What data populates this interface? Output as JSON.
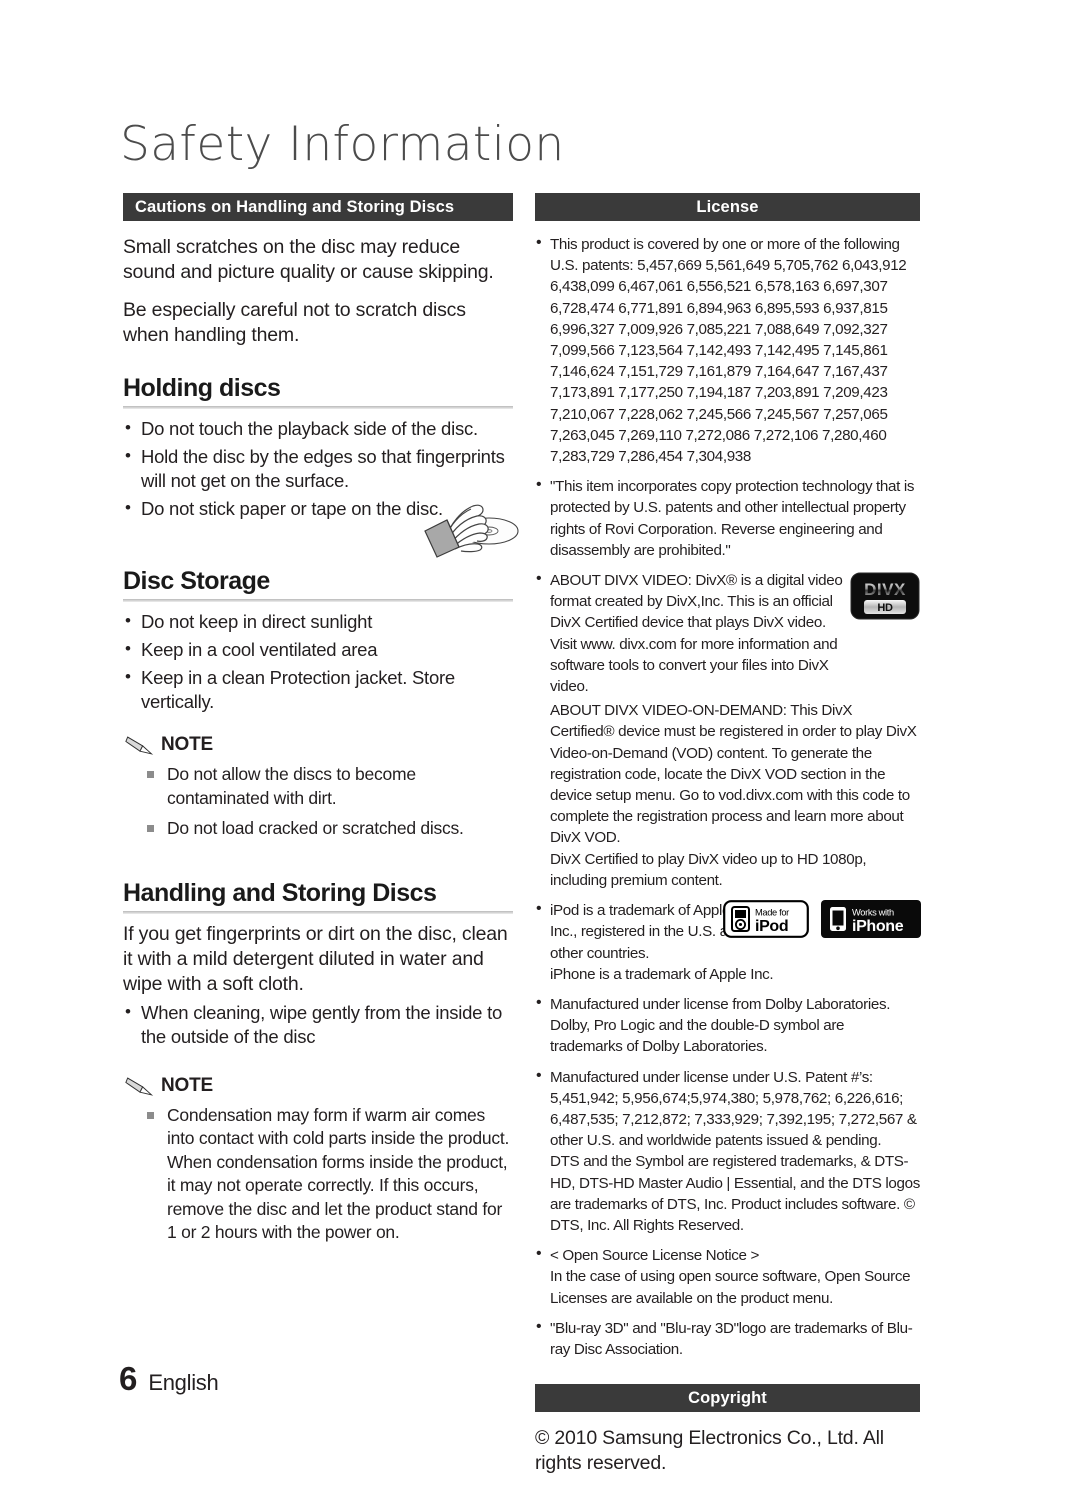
{
  "page": {
    "title": "Safety Information",
    "number": "6",
    "language": "English"
  },
  "left": {
    "header_bar": "Cautions on Handling and Storing Discs",
    "intro": [
      "Small scratches on the disc may reduce sound and picture quality or cause skipping.",
      "Be especially careful not to scratch discs when handling them."
    ],
    "holding": {
      "heading": "Holding discs",
      "bullets": [
        "Do not touch the playback side of the disc.",
        "Hold the disc by the edges so that fingerprints will not get on the surface.",
        "Do not stick paper or tape on the disc."
      ]
    },
    "storage": {
      "heading": "Disc Storage",
      "bullets": [
        "Do not keep in direct sunlight",
        "Keep in a cool ventilated area",
        "Keep in a clean Protection jacket. Store vertically."
      ],
      "note_label": "NOTE",
      "notes": [
        "Do not allow the discs to become contaminated with dirt.",
        "Do not load cracked or scratched discs."
      ]
    },
    "handling": {
      "heading": "Handling and Storing Discs",
      "paragraph": "If you get fingerprints or dirt on the disc, clean it with a mild detergent diluted in water and wipe with a soft cloth.",
      "bullets": [
        "When cleaning, wipe gently from the inside to the outside of the disc"
      ],
      "note_label": "NOTE",
      "notes": [
        "Condensation may form if warm air comes into contact with cold parts inside the product. When condensation forms inside the product, it may not operate correctly. If this occurs, remove the disc and let the product stand for 1 or 2 hours with the power on."
      ]
    }
  },
  "right": {
    "license_bar": "License",
    "patents_intro": "This product is covered by one or more of the following U.S. patents:",
    "patent_numbers": "5,457,669 5,561,649 5,705,762 6,043,912 6,438,099 6,467,061 6,556,521 6,578,163 6,697,307 6,728,474 6,771,891 6,894,963 6,895,593 6,937,815 6,996,327 7,009,926 7,085,221 7,088,649 7,092,327 7,099,566 7,123,564 7,142,493 7,142,495 7,145,861 7,146,624 7,151,729 7,161,879 7,164,647 7,167,437 7,173,891 7,177,250 7,194,187 7,203,891 7,209,423 7,210,067 7,228,062 7,245,566 7,245,567 7,257,065 7,263,045 7,269,110 7,272,086 7,272,106 7,280,460 7,283,729 7,286,454 7,304,938",
    "rovi": "\"This item incorporates copy protection technology that is protected by U.S. patents and other intellectual property rights of Rovi Corporation. Reverse engineering and disassembly are prohibited.\"",
    "divx_video": "ABOUT DIVX VIDEO: DivX® is a digital video format created by DivX,Inc. This is an official DivX Certified device that plays DivX video. Visit www. divx.com for more information and software tools to convert your files into DivX video.",
    "divx_vod": "ABOUT DIVX VIDEO-ON-DEMAND: This DivX Certified® device must be registered in order to play DivX Video-on-Demand (VOD) content. To generate the registration code, locate the DivX VOD section in the device setup menu. Go to vod.divx.com with this code to complete the registration process and learn more about DivX VOD.",
    "divx_certified": "DivX Certified to play DivX video up to HD 1080p, including premium content.",
    "divx_logo": {
      "name": "DIVX",
      "sub": "HD"
    },
    "ipod_line1": "iPod is a trademark of Apple Inc., registered in the U.S. and other countries.",
    "ipod_line2": "iPhone is a trademark of Apple Inc.",
    "badge_ipod": {
      "top": "Made for",
      "bottom": "iPod"
    },
    "badge_iphone": {
      "top": "Works with",
      "bottom": "iPhone"
    },
    "dolby": "Manufactured under license from Dolby Laboratories. Dolby, Pro Logic and the double-D symbol are trademarks of Dolby Laboratories.",
    "dts_patents": "Manufactured under license under U.S. Patent #’s: 5,451,942; 5,956,674;5,974,380; 5,978,762; 6,226,616; 6,487,535; 7,212,872; 7,333,929; 7,392,195; 7,272,567 & other U.S. and worldwide patents issued & pending.",
    "dts_trademarks": "DTS and the Symbol are registered trademarks, & DTS-HD, DTS-HD Master Audio | Essential, and the DTS logos are trademarks of DTS, Inc. Product includes software. © DTS, Inc. All Rights Reserved.",
    "open_source_title": "< Open Source License Notice >",
    "open_source_body": "In the case of using open source software, Open Source Licenses are available on the product menu.",
    "bluray": "\"Blu-ray 3D\" and \"Blu-ray 3D\"logo are trademarks of Blu-ray Disc Association.",
    "copyright_bar": "Copyright",
    "copyright_text": "© 2010 Samsung Electronics Co., Ltd. All rights reserved."
  },
  "colors": {
    "bar_bg": "#3a3a3a",
    "text": "#231f20",
    "rule": "#c9c9c9",
    "note_square": "#8c8c8c"
  }
}
